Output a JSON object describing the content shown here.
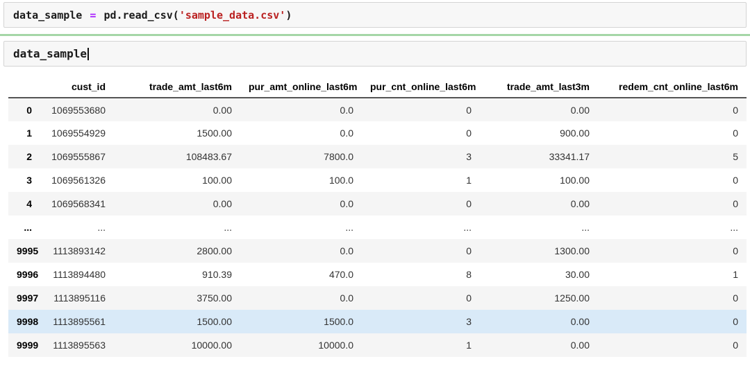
{
  "cells": {
    "cell1": {
      "variable": "data_sample",
      "operator": "=",
      "call_open": "pd.read_csv(",
      "string_arg": "'sample_data.csv'",
      "call_close": ")"
    },
    "cell2": {
      "code": "data_sample"
    }
  },
  "dataframe": {
    "index_header": "",
    "columns": [
      "cust_id",
      "trade_amt_last6m",
      "pur_amt_online_last6m",
      "pur_cnt_online_last6m",
      "trade_amt_last3m",
      "redem_cnt_online_last6m"
    ],
    "rows": [
      {
        "index": "0",
        "values": [
          "1069553680",
          "0.00",
          "0.0",
          "0",
          "0.00",
          "0"
        ],
        "highlighted": false
      },
      {
        "index": "1",
        "values": [
          "1069554929",
          "1500.00",
          "0.0",
          "0",
          "900.00",
          "0"
        ],
        "highlighted": false
      },
      {
        "index": "2",
        "values": [
          "1069555867",
          "108483.67",
          "7800.0",
          "3",
          "33341.17",
          "5"
        ],
        "highlighted": false
      },
      {
        "index": "3",
        "values": [
          "1069561326",
          "100.00",
          "100.0",
          "1",
          "100.00",
          "0"
        ],
        "highlighted": false
      },
      {
        "index": "4",
        "values": [
          "1069568341",
          "0.00",
          "0.0",
          "0",
          "0.00",
          "0"
        ],
        "highlighted": false
      },
      {
        "index": "...",
        "values": [
          "...",
          "...",
          "...",
          "...",
          "...",
          "..."
        ],
        "highlighted": false
      },
      {
        "index": "9995",
        "values": [
          "1113893142",
          "2800.00",
          "0.0",
          "0",
          "1300.00",
          "0"
        ],
        "highlighted": false
      },
      {
        "index": "9996",
        "values": [
          "1113894480",
          "910.39",
          "470.0",
          "8",
          "30.00",
          "1"
        ],
        "highlighted": false
      },
      {
        "index": "9997",
        "values": [
          "1113895116",
          "3750.00",
          "0.0",
          "0",
          "1250.00",
          "0"
        ],
        "highlighted": false
      },
      {
        "index": "9998",
        "values": [
          "1113895561",
          "1500.00",
          "1500.0",
          "3",
          "0.00",
          "0"
        ],
        "highlighted": true
      },
      {
        "index": "9999",
        "values": [
          "1113895563",
          "10000.00",
          "10000.0",
          "1",
          "0.00",
          "0"
        ],
        "highlighted": false
      }
    ]
  },
  "colors": {
    "row_stripe": "#f5f5f5",
    "row_highlight": "#d9eaf8",
    "code_string": "#ba2121",
    "code_operator": "#aa22ff",
    "divider_green": "#a5d6a7",
    "cell_background": "#f7f7f7",
    "cell_border": "#d4d4d4",
    "header_rule": "#545454"
  }
}
